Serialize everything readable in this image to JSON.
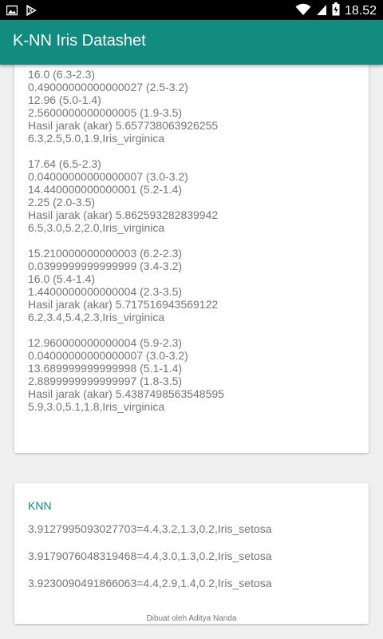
{
  "status_bar": {
    "time": "18.52",
    "icons": [
      "image-icon",
      "play-store-icon",
      "wifi-icon",
      "signal-icon",
      "battery-icon"
    ]
  },
  "app_bar": {
    "title": "K-NN Iris Datashet"
  },
  "results": [
    {
      "lines": [
        "16.0 (6.3-2.3)",
        "0.49000000000000027 (2.5-3.2)",
        "12.96 (5.0-1.4)",
        "2.5600000000000005 (1.9-3.5)",
        "Hasil jarak (akar) 5.657738063926255",
        "6.3,2.5,5.0,1.9,Iris_virginica"
      ]
    },
    {
      "lines": [
        "17.64 (6.5-2.3)",
        "0.04000000000000007 (3.0-3.2)",
        "14.440000000000001 (5.2-1.4)",
        "2.25 (2.0-3.5)",
        "Hasil jarak (akar) 5.862593282839942",
        "6.5,3.0,5.2,2.0,Iris_virginica"
      ]
    },
    {
      "lines": [
        "15.210000000000003 (6.2-2.3)",
        "0.0399999999999999 (3.4-3.2)",
        "16.0 (5.4-1.4)",
        "1.4400000000000004 (2.3-3.5)",
        "Hasil jarak (akar) 5.717516943569122",
        "6.2,3.4,5.4,2.3,Iris_virginica"
      ]
    },
    {
      "lines": [
        "12.960000000000004 (5.9-2.3)",
        "0.04000000000000007 (3.0-3.2)",
        "13.689999999999998 (5.1-1.4)",
        "2.8899999999999997 (1.8-3.5)",
        "Hasil jarak (akar) 5.4387498563548595",
        "5.9,3.0,5.1,1.8,Iris_virginica"
      ]
    }
  ],
  "knn": {
    "title": "KNN",
    "items": [
      "3.9127995093027703=4.4,3.2,1.3,0.2,Iris_setosa",
      "3.9179076048319468=4.4,3.0,1.3,0.2,Iris_setosa",
      "3.9230090491866063=4.4,2.9,1.4,0.2,Iris_setosa"
    ],
    "footer": "Dibuat oleh Aditya Nanda"
  },
  "colors": {
    "primary": "#128c7e",
    "text_secondary": "#757575",
    "background": "#f0f0f0"
  }
}
